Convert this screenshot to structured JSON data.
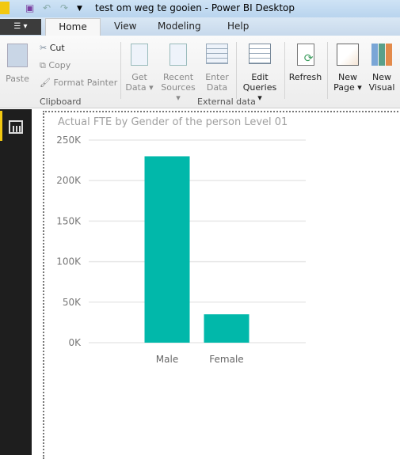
{
  "window": {
    "title": "test om weg te gooien - Power BI Desktop"
  },
  "tabs": [
    "Home",
    "View",
    "Modeling",
    "Help"
  ],
  "ribbon": {
    "paste": "Paste",
    "cut": "Cut",
    "copy": "Copy",
    "format_painter": "Format Painter",
    "clipboard_group": "Clipboard",
    "get_data": [
      "Get",
      "Data"
    ],
    "recent_sources": [
      "Recent",
      "Sources"
    ],
    "enter_data": [
      "Enter",
      "Data"
    ],
    "edit_queries": [
      "Edit",
      "Queries"
    ],
    "refresh": "Refresh",
    "external_group": "External data",
    "new_page": [
      "New",
      "Page"
    ],
    "new_visual": [
      "New",
      "Visual"
    ]
  },
  "colors": {
    "bar": "#01b8aa",
    "accent": "#f2c811"
  },
  "chart_data": {
    "type": "bar",
    "title": "Actual FTE by Gender of the person Level 01",
    "categories": [
      "Male",
      "Female"
    ],
    "values": [
      230000,
      35000
    ],
    "ylim": [
      0,
      250000
    ],
    "yticks": [
      "0K",
      "50K",
      "100K",
      "150K",
      "200K",
      "250K"
    ],
    "grid": true
  }
}
